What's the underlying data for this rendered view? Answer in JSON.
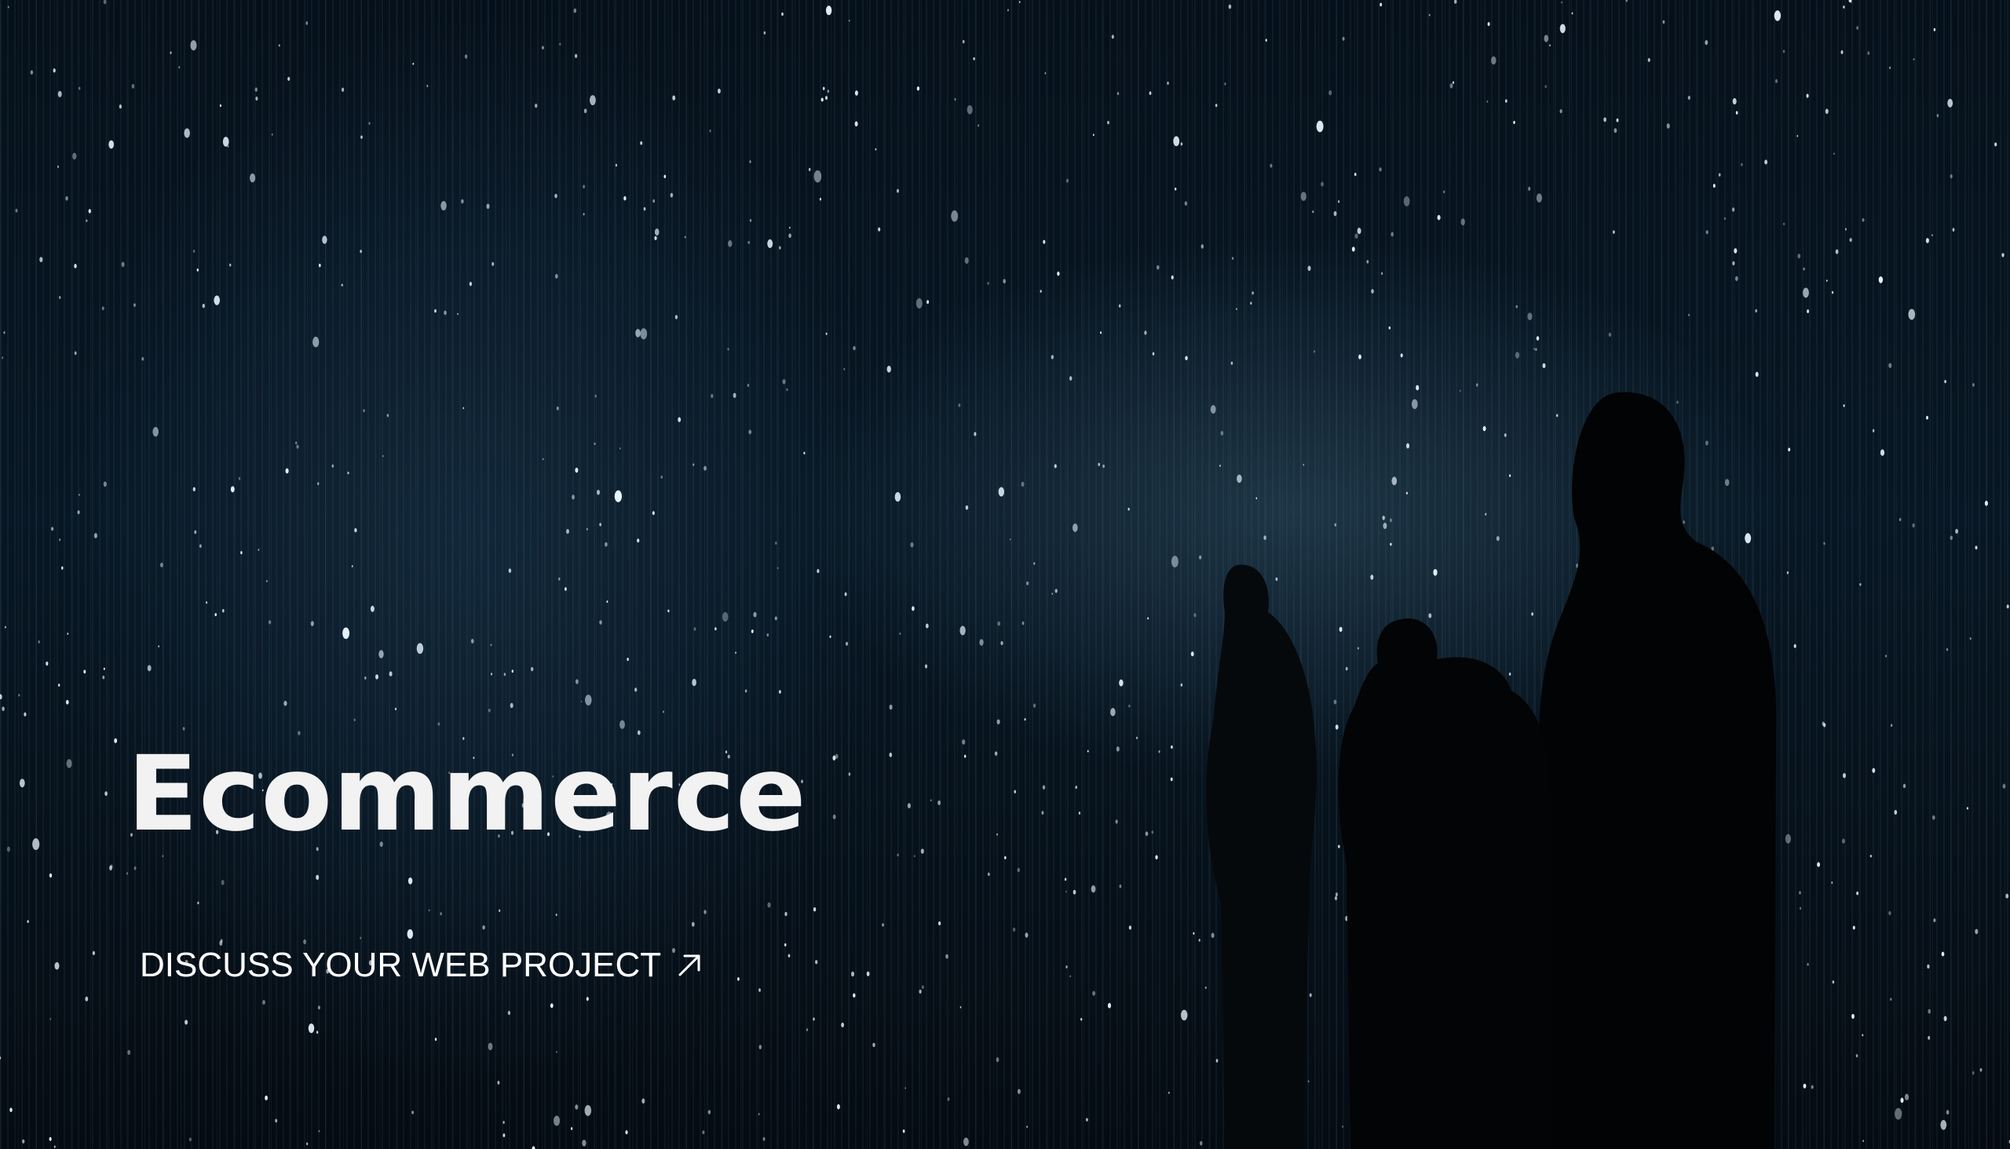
{
  "hero": {
    "title": "Ecommerce",
    "cta": {
      "label": "DISCUSS YOUR WEB PROJECT",
      "icon": "arrow-up-right-icon"
    }
  },
  "colors": {
    "background": "#05080d",
    "text": "#ffffff",
    "light_points": "#e8f4ff"
  }
}
